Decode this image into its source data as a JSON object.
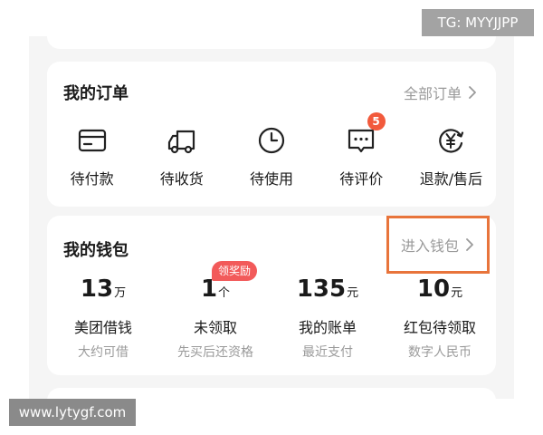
{
  "orders": {
    "title": "我的订单",
    "all_link": "全部订单",
    "items": [
      {
        "label": "待付款",
        "icon": "card-icon"
      },
      {
        "label": "待收货",
        "icon": "truck-icon"
      },
      {
        "label": "待使用",
        "icon": "clock-icon"
      },
      {
        "label": "待评价",
        "icon": "comment-icon",
        "badge": "5"
      },
      {
        "label": "退款/售后",
        "icon": "yen-refund-icon"
      }
    ]
  },
  "wallet": {
    "title": "我的钱包",
    "enter_link": "进入钱包",
    "highlight_color": "#e8743b",
    "items": [
      {
        "value": "13",
        "unit": "万",
        "label": "美团借钱",
        "sub": "大约可借"
      },
      {
        "value": "1",
        "unit": "个",
        "label": "未领取",
        "sub": "先买后还资格",
        "tag": "领奖励"
      },
      {
        "value": "135",
        "unit": "元",
        "label": "我的账单",
        "sub": "最近支付"
      },
      {
        "value": "10",
        "unit": "元",
        "label": "红包待领取",
        "sub": "数字人民币"
      }
    ]
  },
  "watermarks": {
    "tg": "TG: MYYJJPP",
    "url": "www.lytygf.com"
  },
  "colors": {
    "badge": "#f25a3c",
    "tag": "#f25a5a",
    "muted": "#9a9a9a"
  }
}
